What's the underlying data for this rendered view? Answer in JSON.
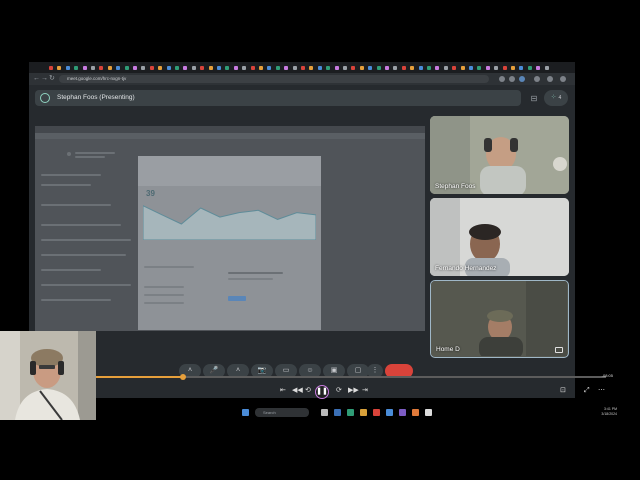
{
  "browser": {
    "url": "meet.google.com/hrc-nxgn-tjv",
    "nav": {
      "back": "←",
      "forward": "→",
      "reload": "↻"
    }
  },
  "meet": {
    "presenter_label": "Stephan Foos (Presenting)",
    "participant_count": "4",
    "participants": [
      {
        "name": "Stephan Foos"
      },
      {
        "name": "Fernando Hernandez"
      },
      {
        "name": "Home D"
      }
    ],
    "controls": [
      "˄",
      "🎤",
      "˄",
      "📷",
      "▭",
      "☺",
      "▣",
      "▢",
      "⋮"
    ]
  },
  "shared_screen": {
    "big_number": "39",
    "chart_values": [
      30,
      22,
      14,
      28,
      20,
      24,
      26,
      18,
      24,
      22
    ]
  },
  "player": {
    "progress": 0.17,
    "time": "-08:05",
    "controls_left": [
      "⇤",
      "◀◀",
      "⟲"
    ],
    "play_glyph": "❚❚",
    "controls_right": [
      "⟳",
      "▶▶",
      "⇥"
    ],
    "extra_right": [
      "⊡",
      "⤢",
      "⋯"
    ]
  },
  "taskbar": {
    "search_placeholder": "Search",
    "time": "3:41 PM",
    "date": "3/18/2024"
  },
  "colors": {
    "accent_teal": "#8fd3c0",
    "end_call_red": "#d9433a",
    "timeline_orange": "#e69f3b",
    "play_ring": "#c87be0"
  },
  "icons": {
    "presenting": "present-to-all-icon",
    "layout": "layout-icon",
    "people": "people-icon",
    "pip": "picture-in-picture-icon"
  }
}
